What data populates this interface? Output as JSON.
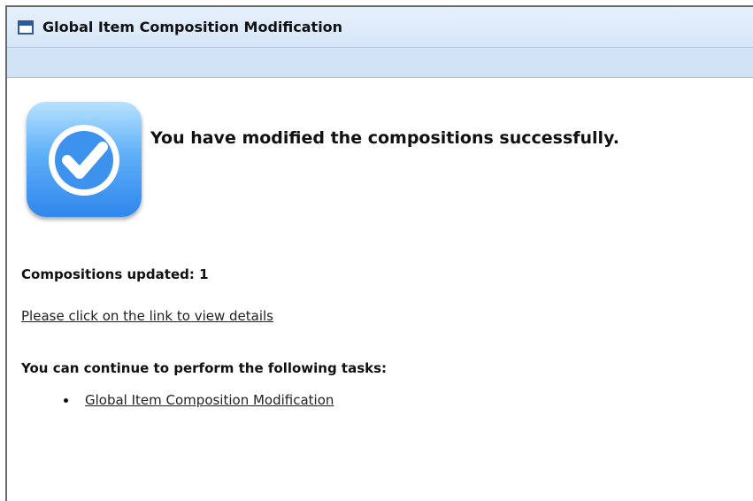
{
  "window": {
    "title": "Global Item Composition Modification"
  },
  "main": {
    "success_message": "You have modified the compositions successfully.",
    "compositions_updated": "Compositions updated: 1",
    "details_link": "Please click on the link to view details",
    "tasks_heading": "You can continue to perform the following tasks:",
    "tasks": [
      {
        "label": "Global Item Composition Modification"
      }
    ]
  },
  "icons": {
    "window": "window-icon",
    "success": "checkmark-icon"
  },
  "colors": {
    "titlebar": "#d6e6f8",
    "subbar": "#d3e3f7",
    "success_blue": "#2f86ec"
  }
}
